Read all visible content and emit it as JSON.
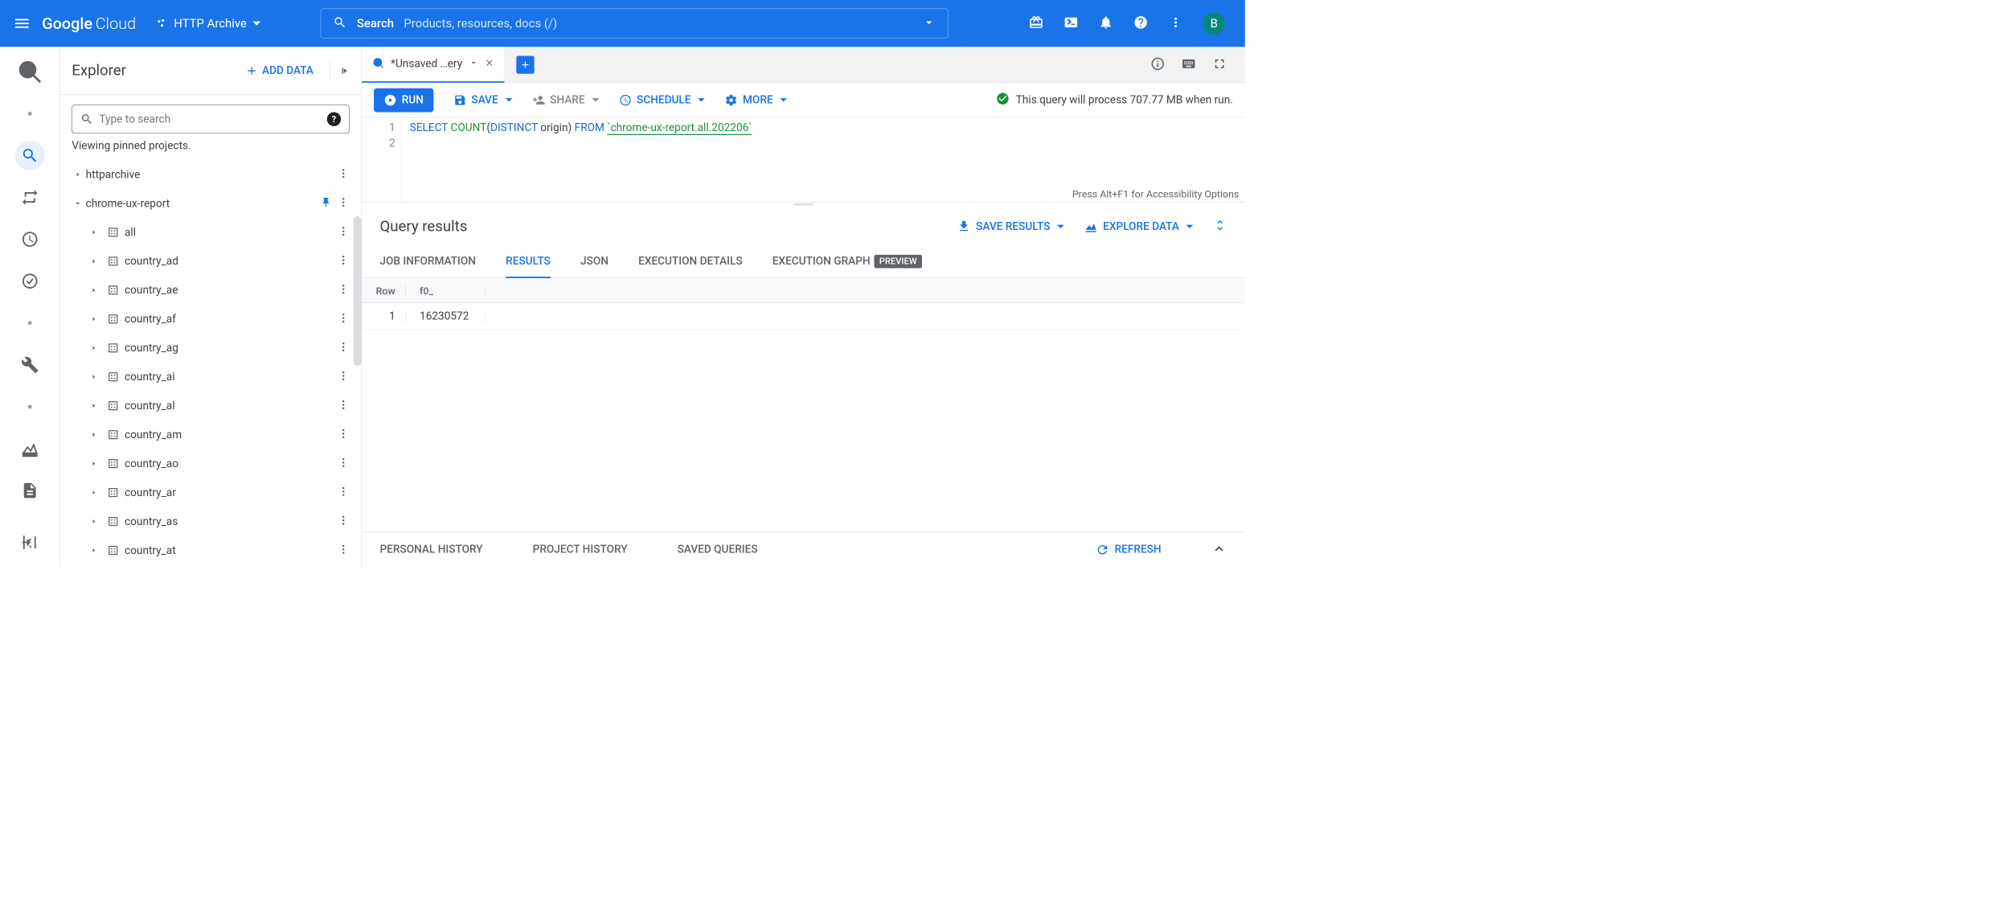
{
  "header": {
    "logo_google": "Google",
    "logo_cloud": "Cloud",
    "project_name": "HTTP Archive",
    "search_label": "Search",
    "search_placeholder": "Products, resources, docs (/)",
    "avatar_letter": "B"
  },
  "explorer": {
    "title": "Explorer",
    "add_data_label": "ADD DATA",
    "search_placeholder": "Type to search",
    "viewing_label": "Viewing pinned projects.",
    "projects": [
      {
        "name": "httparchive",
        "expanded": false,
        "pinned": false
      },
      {
        "name": "chrome-ux-report",
        "expanded": true,
        "pinned": true
      }
    ],
    "datasets": [
      "all",
      "country_ad",
      "country_ae",
      "country_af",
      "country_ag",
      "country_ai",
      "country_al",
      "country_am",
      "country_ao",
      "country_ar",
      "country_as",
      "country_at"
    ]
  },
  "tabs": {
    "active_label": "*Unsaved …ery"
  },
  "toolbar": {
    "run": "RUN",
    "save": "SAVE",
    "share": "SHARE",
    "schedule": "SCHEDULE",
    "more": "MORE",
    "status_text": "This query will process 707.77 MB when run."
  },
  "editor": {
    "lines": [
      "1",
      "2"
    ],
    "sql": {
      "select": "SELECT",
      "count": "COUNT",
      "distinct": "DISTINCT",
      "origin": "origin",
      "from": "FROM",
      "table": "`chrome-ux-report.all.202206`"
    },
    "a11y_hint": "Press Alt+F1 for Accessibility Options"
  },
  "results": {
    "title": "Query results",
    "save_results": "SAVE RESULTS",
    "explore_data": "EXPLORE DATA",
    "tabs": {
      "job_info": "JOB INFORMATION",
      "results": "RESULTS",
      "json": "JSON",
      "exec_details": "EXECUTION DETAILS",
      "exec_graph": "EXECUTION GRAPH",
      "preview_badge": "PREVIEW"
    },
    "columns": {
      "row": "Row",
      "f0": "f0_"
    },
    "rows": [
      {
        "row": "1",
        "f0": "16230572"
      }
    ]
  },
  "bottom": {
    "personal": "PERSONAL HISTORY",
    "project": "PROJECT HISTORY",
    "saved": "SAVED QUERIES",
    "refresh": "REFRESH"
  }
}
